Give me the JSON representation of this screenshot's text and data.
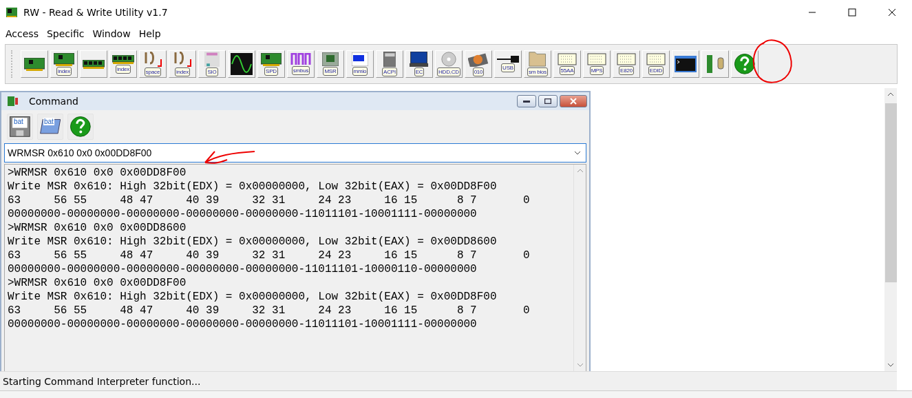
{
  "window": {
    "title": "RW - Read & Write Utility v1.7"
  },
  "menu": [
    "Access",
    "Specific",
    "Window",
    "Help"
  ],
  "toolbar": [
    {
      "kind": "pci"
    },
    {
      "kind": "pci",
      "label": "index"
    },
    {
      "kind": "memory"
    },
    {
      "kind": "memory",
      "label": "index"
    },
    {
      "kind": "io",
      "label": "space"
    },
    {
      "kind": "io",
      "label": "index"
    },
    {
      "kind": "sio",
      "label": "SIO"
    },
    {
      "kind": "scope"
    },
    {
      "kind": "pci",
      "label": "SPD"
    },
    {
      "kind": "smbus",
      "label": "smbus"
    },
    {
      "kind": "cpu",
      "label": "MSR"
    },
    {
      "kind": "mmio",
      "label": "mmio"
    },
    {
      "kind": "acpi",
      "label": "ACPI"
    },
    {
      "kind": "laptop",
      "label": "EC"
    },
    {
      "kind": "disc",
      "label": "HDD,CD"
    },
    {
      "kind": "disk",
      "label": "010"
    },
    {
      "kind": "usb",
      "label": "USB"
    },
    {
      "kind": "folder",
      "label": "sm bios"
    },
    {
      "kind": "chip",
      "label": "55AA"
    },
    {
      "kind": "chip",
      "label": "MPS"
    },
    {
      "kind": "chip",
      "label": "E820"
    },
    {
      "kind": "chip",
      "label": "EDID"
    },
    {
      "kind": "console"
    },
    {
      "kind": "board"
    },
    {
      "kind": "help"
    }
  ],
  "command_window": {
    "title": "Command",
    "toolbar": [
      {
        "kind": "save",
        "label": "bat"
      },
      {
        "kind": "script",
        "label": "bat"
      },
      {
        "kind": "help"
      }
    ],
    "input": {
      "value": "WRMSR 0x610 0x0 0x00DD8F00"
    },
    "output": [
      ">WRMSR 0x610 0x0 0x00DD8F00",
      "Write MSR 0x610: High 32bit(EDX) = 0x00000000, Low 32bit(EAX) = 0x00DD8F00",
      "63     56 55     48 47     40 39     32 31     24 23     16 15      8 7       0",
      "00000000-00000000-00000000-00000000-00000000-11011101-10001111-00000000",
      ">WRMSR 0x610 0x0 0x00DD8600",
      "Write MSR 0x610: High 32bit(EDX) = 0x00000000, Low 32bit(EAX) = 0x00DD8600",
      "63     56 55     48 47     40 39     32 31     24 23     16 15      8 7       0",
      "00000000-00000000-00000000-00000000-00000000-11011101-10000110-00000000",
      ">WRMSR 0x610 0x0 0x00DD8F00",
      "Write MSR 0x610: High 32bit(EDX) = 0x00000000, Low 32bit(EAX) = 0x00DD8F00",
      "63     56 55     48 47     40 39     32 31     24 23     16 15      8 7       0",
      "00000000-00000000-00000000-00000000-00000000-11011101-10001111-00000000"
    ]
  },
  "status_bar": "Starting Command Interpreter function..."
}
